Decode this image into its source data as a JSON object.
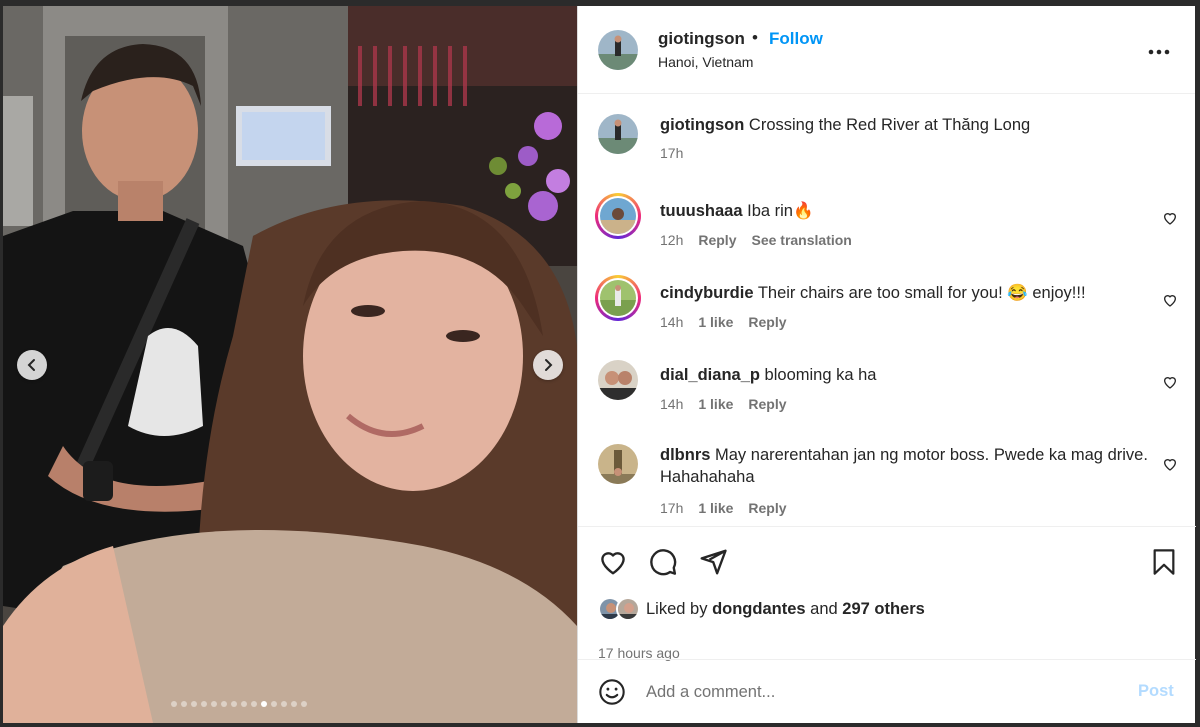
{
  "post": {
    "username": "giotingson",
    "separator": "•",
    "follow_label": "Follow",
    "location": "Hanoi, Vietnam",
    "more_label": "•••"
  },
  "caption": {
    "username": "giotingson",
    "text": "Crossing the Red River at Thăng Long",
    "time": "17h"
  },
  "comments": [
    {
      "username": "tuuushaaa",
      "text": "Iba rin🔥",
      "time": "12h",
      "likes": "",
      "reply": "Reply",
      "translate": "See translation"
    },
    {
      "username": "cindyburdie",
      "text": "Their chairs are too small for you! 😂 enjoy!!!",
      "time": "14h",
      "likes": "1 like",
      "reply": "Reply"
    },
    {
      "username": "dial_diana_p",
      "text": "blooming ka ha",
      "time": "14h",
      "likes": "1 like",
      "reply": "Reply"
    },
    {
      "username": "dlbnrs",
      "text": "May narerentahan jan ng motor boss. Pwede ka mag drive. Hahahahaha",
      "time": "17h",
      "likes": "1 like",
      "reply": "Reply"
    }
  ],
  "likes": {
    "prefix": "Liked by",
    "user": "dongdantes",
    "joiner": "and",
    "others": "297 others"
  },
  "time_ago": "17 hours ago",
  "comment_box": {
    "placeholder": "Add a comment...",
    "post_label": "Post"
  },
  "carousel": {
    "total": 14,
    "active_index": 9
  },
  "colors": {
    "accent": "#0095f6",
    "post_disabled": "#b3dbff",
    "text": "#262626",
    "muted": "#737373"
  },
  "icons": [
    "chevron-left-icon",
    "chevron-right-icon",
    "more-icon",
    "heart-icon",
    "comment-icon",
    "share-icon",
    "bookmark-icon",
    "emoji-icon"
  ]
}
